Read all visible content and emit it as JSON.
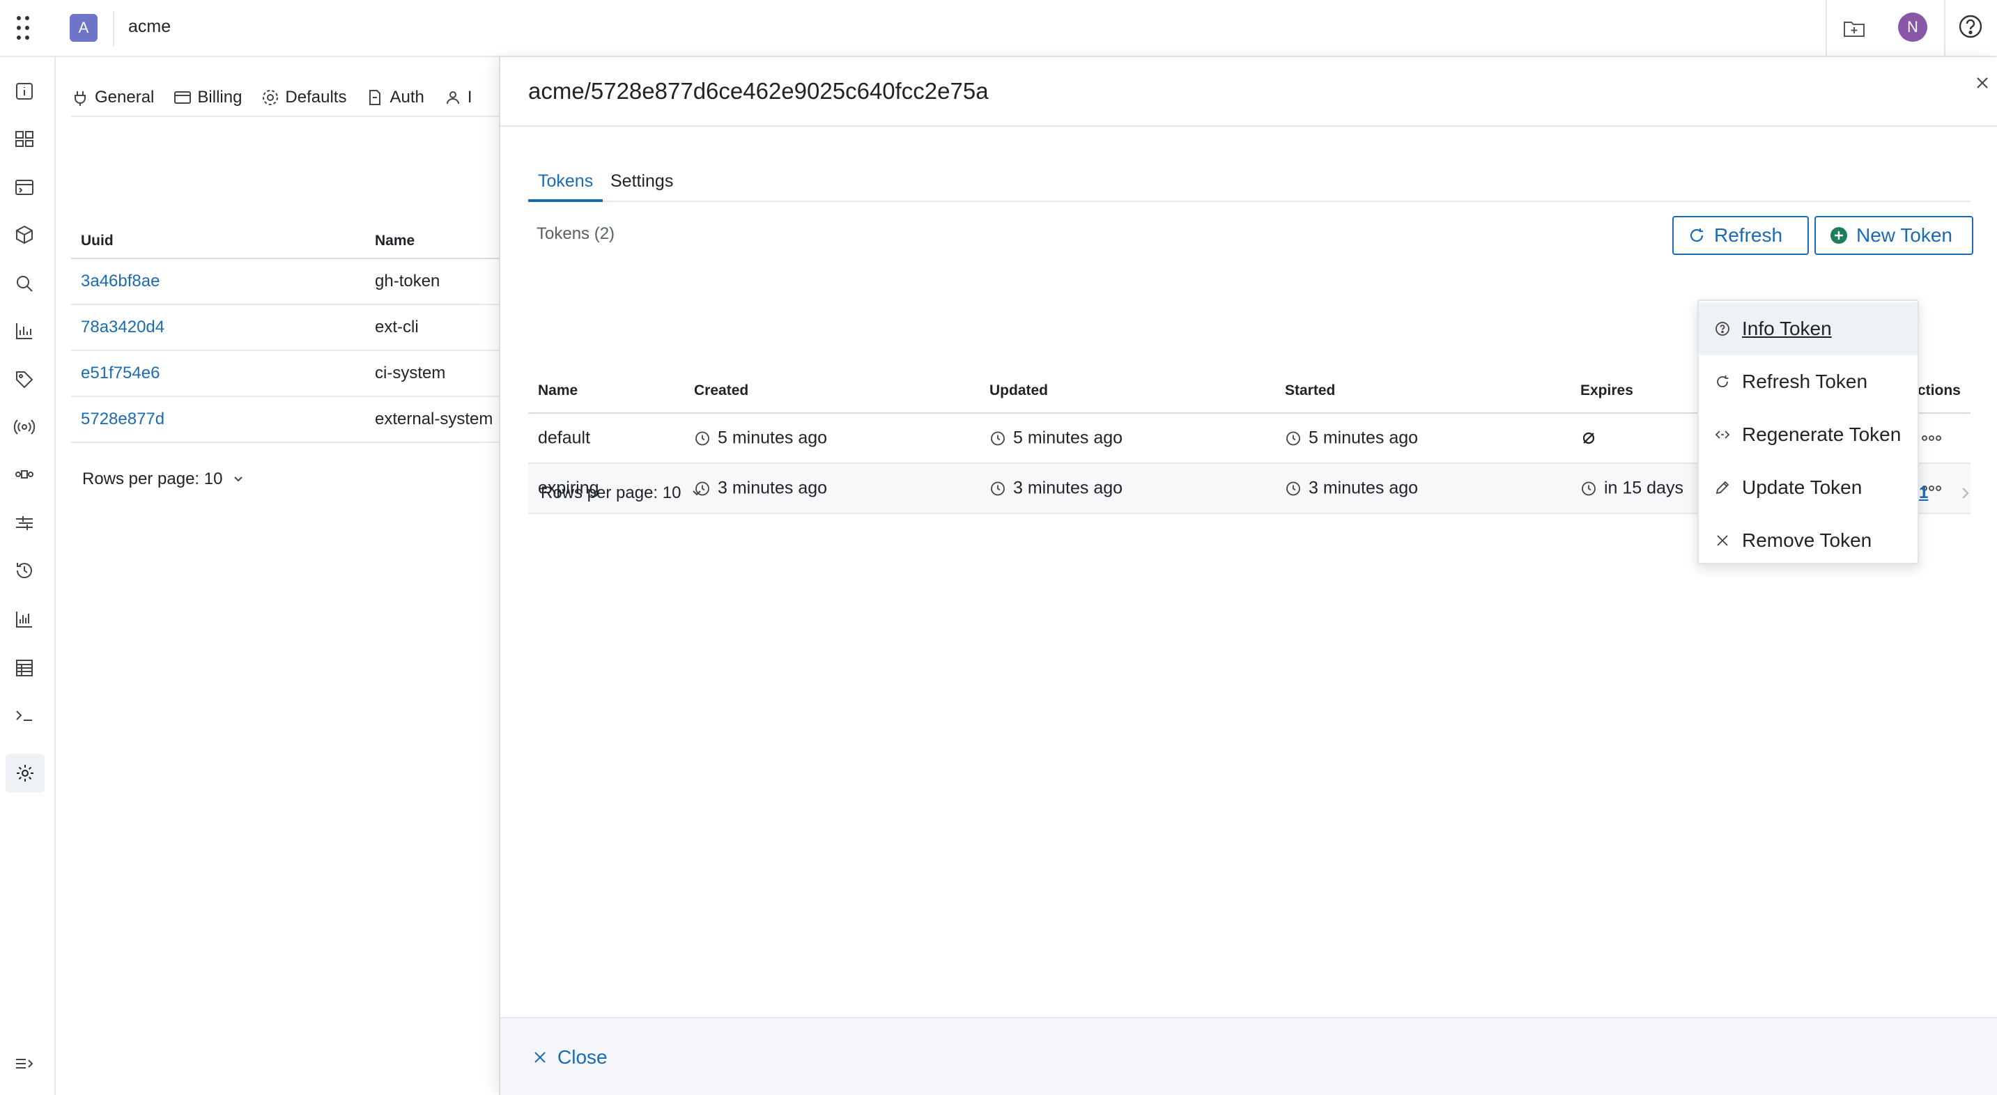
{
  "topbar": {
    "org_initial": "A",
    "org_name": "acme",
    "user_initial": "N"
  },
  "background": {
    "tabs": [
      {
        "label": "General",
        "icon": "plug-icon"
      },
      {
        "label": "Billing",
        "icon": "credit-card-icon"
      },
      {
        "label": "Defaults",
        "icon": "gear-icon"
      },
      {
        "label": "Auth",
        "icon": "login-icon"
      },
      {
        "label": "I",
        "icon": "user-icon"
      }
    ],
    "table": {
      "headers": [
        "Uuid",
        "Name"
      ],
      "rows": [
        {
          "uuid": "3a46bf8ae",
          "name": "gh-token"
        },
        {
          "uuid": "78a3420d4",
          "name": "ext-cli"
        },
        {
          "uuid": "e51f754e6",
          "name": "ci-system"
        },
        {
          "uuid": "5728e877d",
          "name": "external-system"
        }
      ]
    },
    "rows_per_page": "Rows per page: 10"
  },
  "drawer": {
    "title": "acme/5728e877d6ce462e9025c640fcc2e75a",
    "tabs": [
      {
        "label": "Tokens",
        "active": true
      },
      {
        "label": "Settings",
        "active": false
      }
    ],
    "tokens_count": "Tokens (2)",
    "refresh_label": "Refresh",
    "new_token_label": "New Token",
    "table": {
      "headers": [
        "Name",
        "Created",
        "Updated",
        "Started",
        "Expires",
        "ctions"
      ],
      "rows": [
        {
          "name": "default",
          "created": "5 minutes ago",
          "updated": "5 minutes ago",
          "started": "5 minutes ago",
          "expires": ""
        },
        {
          "name": "expiring",
          "created": "3 minutes ago",
          "updated": "3 minutes ago",
          "started": "3 minutes ago",
          "expires": "in 15 days"
        }
      ]
    },
    "rows_per_page": "Rows per page: 10",
    "page_number": "1",
    "close_label": "Close"
  },
  "menu": {
    "items": [
      {
        "label": "Info Token",
        "icon": "question-circle-icon"
      },
      {
        "label": "Refresh Token",
        "icon": "refresh-icon"
      },
      {
        "label": "Regenerate Token",
        "icon": "code-icon"
      },
      {
        "label": "Update Token",
        "icon": "pencil-icon"
      },
      {
        "label": "Remove Token",
        "icon": "close-icon"
      }
    ]
  },
  "colors": {
    "accent": "#1b6bb3",
    "org_badge": "#6e74c9",
    "avatar": "#8a56a8"
  }
}
